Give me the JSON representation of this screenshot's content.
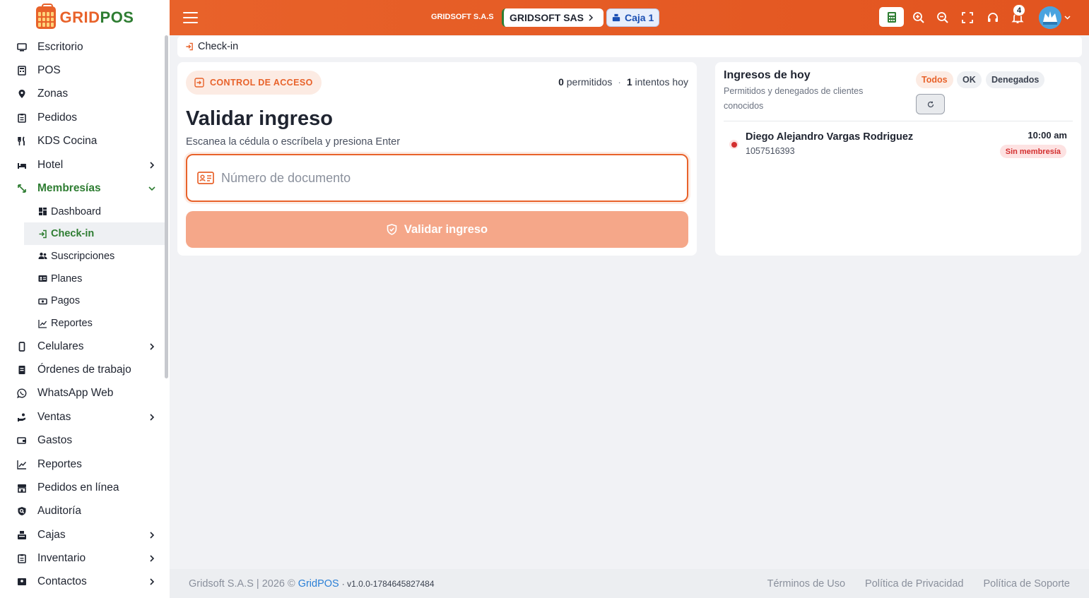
{
  "brand": {
    "part1": "GRID",
    "part2": "POS"
  },
  "sidebar": {
    "items_top": [
      {
        "label": "Escritorio",
        "icon": "desktop-icon"
      },
      {
        "label": "POS",
        "icon": "cash-register-icon"
      },
      {
        "label": "Zonas",
        "icon": "location-pin-icon"
      },
      {
        "label": "Pedidos",
        "icon": "clipboard-icon"
      },
      {
        "label": "KDS Cocina",
        "icon": "utensils-icon"
      },
      {
        "label": "Hotel",
        "icon": "bed-icon",
        "expandable": true
      },
      {
        "label": "Membresías",
        "icon": "arrows-icon",
        "expandable": true,
        "open": true
      }
    ],
    "sub_items": [
      {
        "label": "Dashboard",
        "icon": "grid-icon"
      },
      {
        "label": "Check-in",
        "icon": "login-icon",
        "active": true
      },
      {
        "label": "Suscripciones",
        "icon": "users-icon"
      },
      {
        "label": "Planes",
        "icon": "id-card-icon"
      },
      {
        "label": "Pagos",
        "icon": "money-icon"
      },
      {
        "label": "Reportes",
        "icon": "chart-line-icon"
      }
    ],
    "items_bottom": [
      {
        "label": "Celulares",
        "icon": "phone-icon",
        "expandable": true
      },
      {
        "label": "Órdenes de trabajo",
        "icon": "file-icon"
      },
      {
        "label": "WhatsApp Web",
        "icon": "whatsapp-icon"
      },
      {
        "label": "Ventas",
        "icon": "hand-coins-icon",
        "expandable": true
      },
      {
        "label": "Gastos",
        "icon": "wallet-icon"
      },
      {
        "label": "Reportes",
        "icon": "chart-line-icon"
      },
      {
        "label": "Pedidos en línea",
        "icon": "store-icon"
      },
      {
        "label": "Auditoría",
        "icon": "shield-search-icon"
      },
      {
        "label": "Cajas",
        "icon": "cash-box-icon",
        "expandable": true
      },
      {
        "label": "Inventario",
        "icon": "inventory-icon",
        "expandable": true
      },
      {
        "label": "Contactos",
        "icon": "contacts-icon",
        "expandable": true
      }
    ]
  },
  "header": {
    "company_label": "GRIDSOFT S.A.S",
    "company_pill": "GRIDSOFT SAS",
    "caja": "Caja 1",
    "notification_count": "4"
  },
  "breadcrumb": {
    "label": "Check-in"
  },
  "validate": {
    "chip": "CONTROL DE ACCESO",
    "permitted_count": "0",
    "permitted_label": "permitidos",
    "separator": "·",
    "attempts_count": "1",
    "attempts_label": "intentos hoy",
    "title": "Validar ingreso",
    "subtitle": "Escanea la cédula o escríbela y presiona Enter",
    "input_placeholder": "Número de documento",
    "input_value": "",
    "button": "Validar ingreso"
  },
  "today": {
    "title": "Ingresos de hoy",
    "subtitle": "Permitidos y denegados de clientes conocidos",
    "filters": {
      "all": "Todos",
      "ok": "OK",
      "denied": "Denegados"
    },
    "entries": [
      {
        "name": "Diego Alejandro Vargas Rodriguez",
        "document": "1057516393",
        "time": "10:00 am",
        "status": "Sin membresía"
      }
    ]
  },
  "footer": {
    "company": "Gridsoft S.A.S | 2026 ©",
    "brand": "GridPOS",
    "version": "· v1.0.0-1784645827484",
    "links": [
      "Términos de Uso",
      "Política de Privacidad",
      "Política de Soporte"
    ]
  },
  "colors": {
    "accent": "#e8622a",
    "green": "#2e7d32",
    "danger": "#d32f2f",
    "link": "#2a7fd6"
  }
}
